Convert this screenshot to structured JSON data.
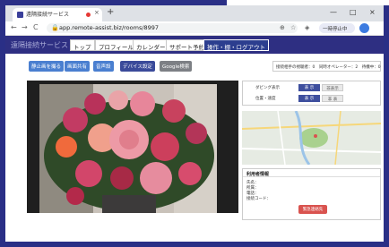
{
  "browser": {
    "tab_title": "遠隔接続サービス",
    "tab_close": "×",
    "new_tab": "+",
    "window_controls": [
      "—",
      "□",
      "×"
    ],
    "nav": [
      "←",
      "→",
      "C"
    ],
    "lock": "🔒",
    "url": "app.remote-assist.biz/rooms/8997",
    "toolbar_icons": [
      "⊕",
      "☆",
      "◈"
    ],
    "profile_label": "一時停止中"
  },
  "app": {
    "brand": "遠隔接続サービス",
    "nav": [
      "トップ",
      "プロフィール",
      "カレンダー",
      "サポート予約",
      "操作・棚・ログアウト"
    ]
  },
  "actions": [
    "静止画を撮る",
    "画面共有",
    "音声設",
    "デバイス設定",
    "Google検索"
  ],
  "status": {
    "text": "接続相手の視聴者：0　同時オペレーター：2　待機中：0"
  },
  "controls": {
    "row1_label": "ダビング表示",
    "row1_on": "表 示",
    "row1_off": "非表示",
    "row2_label": "位置・速度",
    "row2_on": "表 示",
    "row2_off": "非 表"
  },
  "info": {
    "title": "利用者情報",
    "rows": [
      "氏名：",
      "所属：",
      "電話：",
      "接続コード："
    ],
    "button": "緊急連絡先"
  },
  "colors": {
    "header": "#2e2f82",
    "accent_blue": "#4a7fd0",
    "danger": "#d9534f"
  }
}
